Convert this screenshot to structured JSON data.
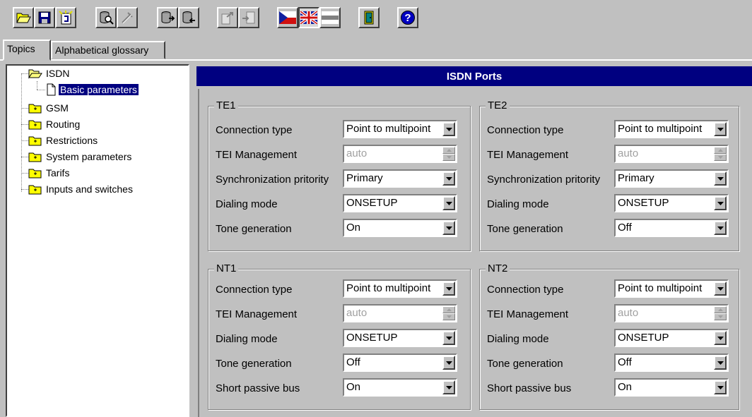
{
  "toolbar": {
    "buttons": [
      {
        "icon": "open-folder-icon"
      },
      {
        "icon": "save-icon"
      },
      {
        "icon": "import-icon"
      },
      {
        "icon": "database-search-icon"
      },
      {
        "icon": "disabled-tool-icon"
      },
      {
        "icon": "read-config-icon"
      },
      {
        "icon": "write-config-icon"
      },
      {
        "icon": "export-icon"
      },
      {
        "icon": "upload-icon"
      },
      {
        "icon": "czech-flag-icon"
      },
      {
        "icon": "uk-flag-icon"
      },
      {
        "icon": "neutral-flag-icon"
      },
      {
        "icon": "exit-door-icon"
      },
      {
        "icon": "help-icon"
      }
    ]
  },
  "tabs": {
    "topics": "Topics",
    "glossary": "Alphabetical glossary"
  },
  "tree": {
    "isdn": "ISDN",
    "basic": "Basic parameters",
    "gsm": "GSM",
    "routing": "Routing",
    "restrictions": "Restrictions",
    "system": "System parameters",
    "tarifs": "Tarifs",
    "inputs": "Inputs and switches"
  },
  "panel": {
    "title": "ISDN Ports"
  },
  "labels": {
    "connection_type": "Connection type",
    "tei": "TEI Management",
    "sync": "Synchronization pritority",
    "dialing": "Dialing mode",
    "tone": "Tone generation",
    "short_bus": "Short passive bus"
  },
  "te1": {
    "title": "TE1",
    "connection_type": "Point to multipoint",
    "tei": "auto",
    "sync": "Primary",
    "dialing": "ONSETUP",
    "tone": "On"
  },
  "te2": {
    "title": "TE2",
    "connection_type": "Point to multipoint",
    "tei": "auto",
    "sync": "Primary",
    "dialing": "ONSETUP",
    "tone": "Off"
  },
  "nt1": {
    "title": "NT1",
    "connection_type": "Point to multipoint",
    "tei": "auto",
    "dialing": "ONSETUP",
    "tone": "Off",
    "short_bus": "On"
  },
  "nt2": {
    "title": "NT2",
    "connection_type": "Point to multipoint",
    "tei": "auto",
    "dialing": "ONSETUP",
    "tone": "Off",
    "short_bus": "On"
  },
  "colors": {
    "title_bar": "#000080",
    "selection": "#000080",
    "face": "#c0c0c0"
  }
}
